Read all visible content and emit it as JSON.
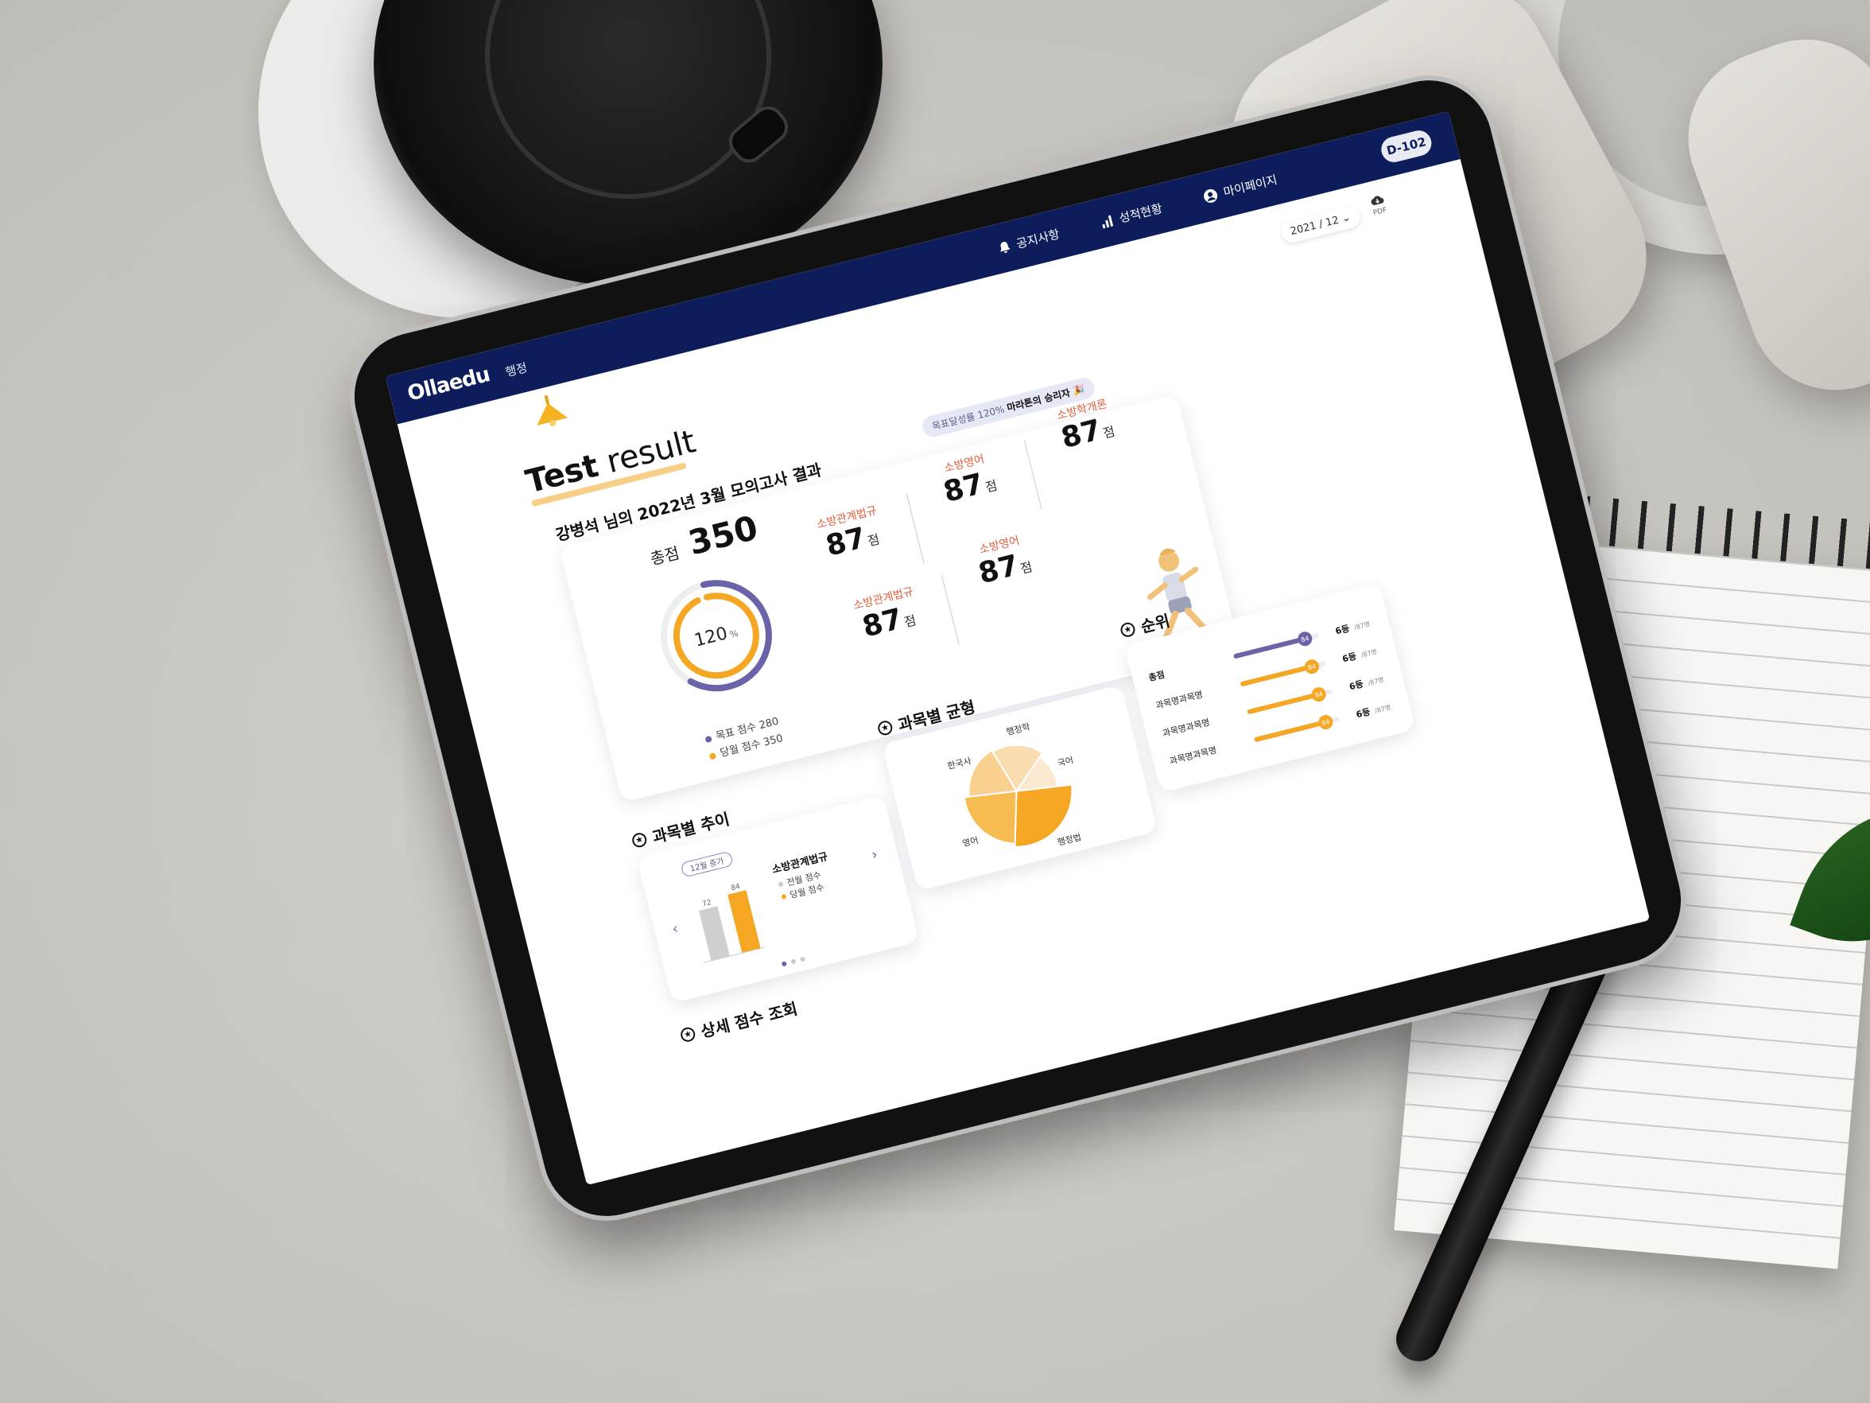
{
  "app": {
    "logo": "Ollaedu",
    "logo_sub": "행정"
  },
  "nav": {
    "items": [
      {
        "label": "공지사항",
        "icon": "bell-icon"
      },
      {
        "label": "성적현황",
        "icon": "bar-chart-icon"
      },
      {
        "label": "마이페이지",
        "icon": "user-icon"
      }
    ],
    "dday": "D-102"
  },
  "toolbar": {
    "date": "2021 / 12",
    "pdf_label": "PDF"
  },
  "page": {
    "title_bold": "Test",
    "title_rest": " result",
    "exam_title": "강병석 님의 2022년 3월 모의고사 결과",
    "goal_pill_prefix": "목표달성률 120%",
    "goal_pill_bold": "마라톤의 승리자 🎉"
  },
  "summary": {
    "total_label": "총점",
    "total_value": "350",
    "donut_label": "120",
    "donut_unit": "%",
    "donut_progress": 1.2,
    "legend": [
      {
        "label": "목표 점수 280",
        "color": "#6b63a8"
      },
      {
        "label": "당월 점수 350",
        "color": "#f5a623"
      }
    ],
    "subjects": [
      {
        "name": "소방관계법규",
        "score": "87",
        "unit": "점"
      },
      {
        "name": "소방영어",
        "score": "87",
        "unit": "점"
      },
      {
        "name": "소방학개론",
        "score": "87",
        "unit": "점"
      },
      {
        "name": "소방관계법규",
        "score": "87",
        "unit": "점"
      },
      {
        "name": "소방영어",
        "score": "87",
        "unit": "점"
      }
    ]
  },
  "sections": {
    "trend": "과목별 추이",
    "balance": "과목별 균형",
    "rank": "순위",
    "detail": "상세 점수 조회"
  },
  "trend": {
    "badge": "12월 증가",
    "subject": "소방관계법규",
    "legend_prev": "전월 점수",
    "legend_curr": "당월 점수",
    "prev_value": 72,
    "curr_value": 84,
    "ymax": 100
  },
  "balance": {
    "labels": [
      "행정학",
      "국어",
      "행정법",
      "영어",
      "한국사"
    ],
    "values": [
      20,
      15,
      30,
      25,
      20
    ]
  },
  "rank": {
    "rows": [
      {
        "label": "총점",
        "value": 84,
        "rank": "6등",
        "of": "/87명",
        "bold": true
      },
      {
        "label": "과목명과목명",
        "value": 84,
        "rank": "6등",
        "of": "/87명",
        "bold": false
      },
      {
        "label": "과목명과목명",
        "value": 84,
        "rank": "6등",
        "of": "/87명",
        "bold": false
      },
      {
        "label": "과목명과목명",
        "value": 84,
        "rank": "6등",
        "of": "/87명",
        "bold": false
      }
    ]
  },
  "chart_data": [
    {
      "type": "bar",
      "categories": [
        "전월 점수",
        "당월 점수"
      ],
      "values": [
        72,
        84
      ],
      "title": "소방관계법규",
      "ylim": [
        0,
        100
      ]
    },
    {
      "type": "pie",
      "categories": [
        "행정학",
        "국어",
        "행정법",
        "영어",
        "한국사"
      ],
      "values": [
        20,
        15,
        30,
        25,
        20
      ]
    }
  ],
  "colors": {
    "navy": "#0d1d5c",
    "accent": "#f5a623",
    "purple": "#6b63a8",
    "subject_red": "#e35d3a"
  }
}
